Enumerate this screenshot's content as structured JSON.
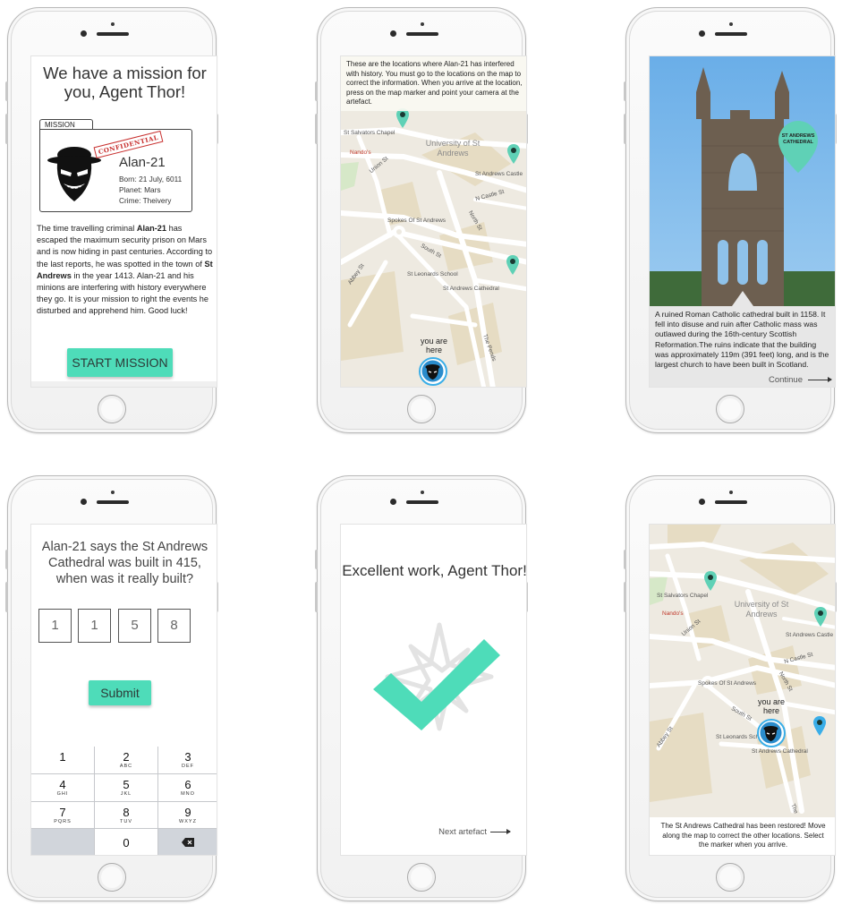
{
  "phone1": {
    "title": "We have a mission for you, Agent Thor!",
    "mission_tab": "MISSION",
    "stamp": "CONFIDENTIAL",
    "criminal_name": "Alan-21",
    "born": "Born: 21 July, 6011",
    "planet": "Planet: Mars",
    "crime": "Crime: Theivery",
    "story_1": "The time travelling criminal ",
    "story_name": "Alan-21",
    "story_2": " has escaped the maximum security prison on Mars and is now hiding in past centuries. According to the last reports, he was spotted in the town of ",
    "story_town": "St Andrews",
    "story_3": " in the year 1413. Alan-21 and his minions are interfering with history everywhere they go. It is your mission to right the events he disturbed and apprehend him. Good luck!",
    "button": "START MISSION"
  },
  "phone2": {
    "info": "These are the locations where Alan-21 has interfered with history. You must go to the locations on the map to correct the information. When you arrive at the location, press on the map marker and point your camera at the artefact.",
    "labels": {
      "chapel": "St Salvators Chapel",
      "nandos": "Nando's",
      "university": "University of St Andrews",
      "castle": "St Andrews Castle",
      "spokes": "Spokes Of St Andrews",
      "leonards": "St Leonards School",
      "cathedral": "St Andrews Cathedral",
      "union_st": "Union St",
      "ncastle_st": "N Castle St",
      "north_st": "North St",
      "south_st": "South St",
      "abbey_st": "Abbey St",
      "pends": "The Pends"
    },
    "you_are_here": "you are here"
  },
  "phone3": {
    "pin_label": "ST ANDREWS CATHEDRAL",
    "description": "A ruined Roman Catholic cathedral built in 1158. It fell into disuse and ruin after Catholic mass was outlawed during the 16th-century Scottish Reformation.The ruins indicate that the building was approximately 119m (391 feet) long, and is the largest church to have been built in Scotland.",
    "continue": "Continue"
  },
  "phone4": {
    "question": "Alan-21 says the St Andrews Cathedral was built in 415, when was it really built?",
    "digits": [
      "1",
      "1",
      "5",
      "8"
    ],
    "submit": "Submit",
    "keypad": [
      {
        "num": "1",
        "letters": ""
      },
      {
        "num": "2",
        "letters": "ABC"
      },
      {
        "num": "3",
        "letters": "DEF"
      },
      {
        "num": "4",
        "letters": "GHI"
      },
      {
        "num": "5",
        "letters": "JKL"
      },
      {
        "num": "6",
        "letters": "MNO"
      },
      {
        "num": "7",
        "letters": "PQRS"
      },
      {
        "num": "8",
        "letters": "TUV"
      },
      {
        "num": "9",
        "letters": "WXYZ"
      },
      {
        "num": "0",
        "letters": ""
      }
    ]
  },
  "phone5": {
    "title": "Excellent work, Agent Thor!",
    "next": "Next artefact"
  },
  "phone6": {
    "labels": {
      "chapel": "St Salvators Chapel",
      "nandos": "Nando's",
      "university": "University of St Andrews",
      "castle": "St Andrews Castle",
      "spokes": "Spokes Of St Andrews",
      "leonards": "St Leonards School",
      "cathedral": "St Andrews Cathedral",
      "union_st": "Union St",
      "ncastle_st": "N Castle St",
      "north_st": "North St",
      "south_st": "South St",
      "abbey_st": "Abbey St",
      "pends": "The"
    },
    "you_are_here": "you are here",
    "info": "The St Andrews Cathedral has been restored! Move along the map to correct the other locations. Select the marker when you arrive."
  },
  "colors": {
    "accent": "#4edcb9",
    "pin": "#5fd1b6",
    "marker_ring": "#3aaee8",
    "map_bg": "#eeeae1",
    "road": "#ffffff",
    "park": "#d6e8c8",
    "block": "#e6dcc3"
  },
  "icons": [
    "agent-face-icon",
    "map-pin-icon",
    "villain-avatar-icon",
    "checkmark-icon",
    "compass-star-icon",
    "backspace-icon"
  ]
}
